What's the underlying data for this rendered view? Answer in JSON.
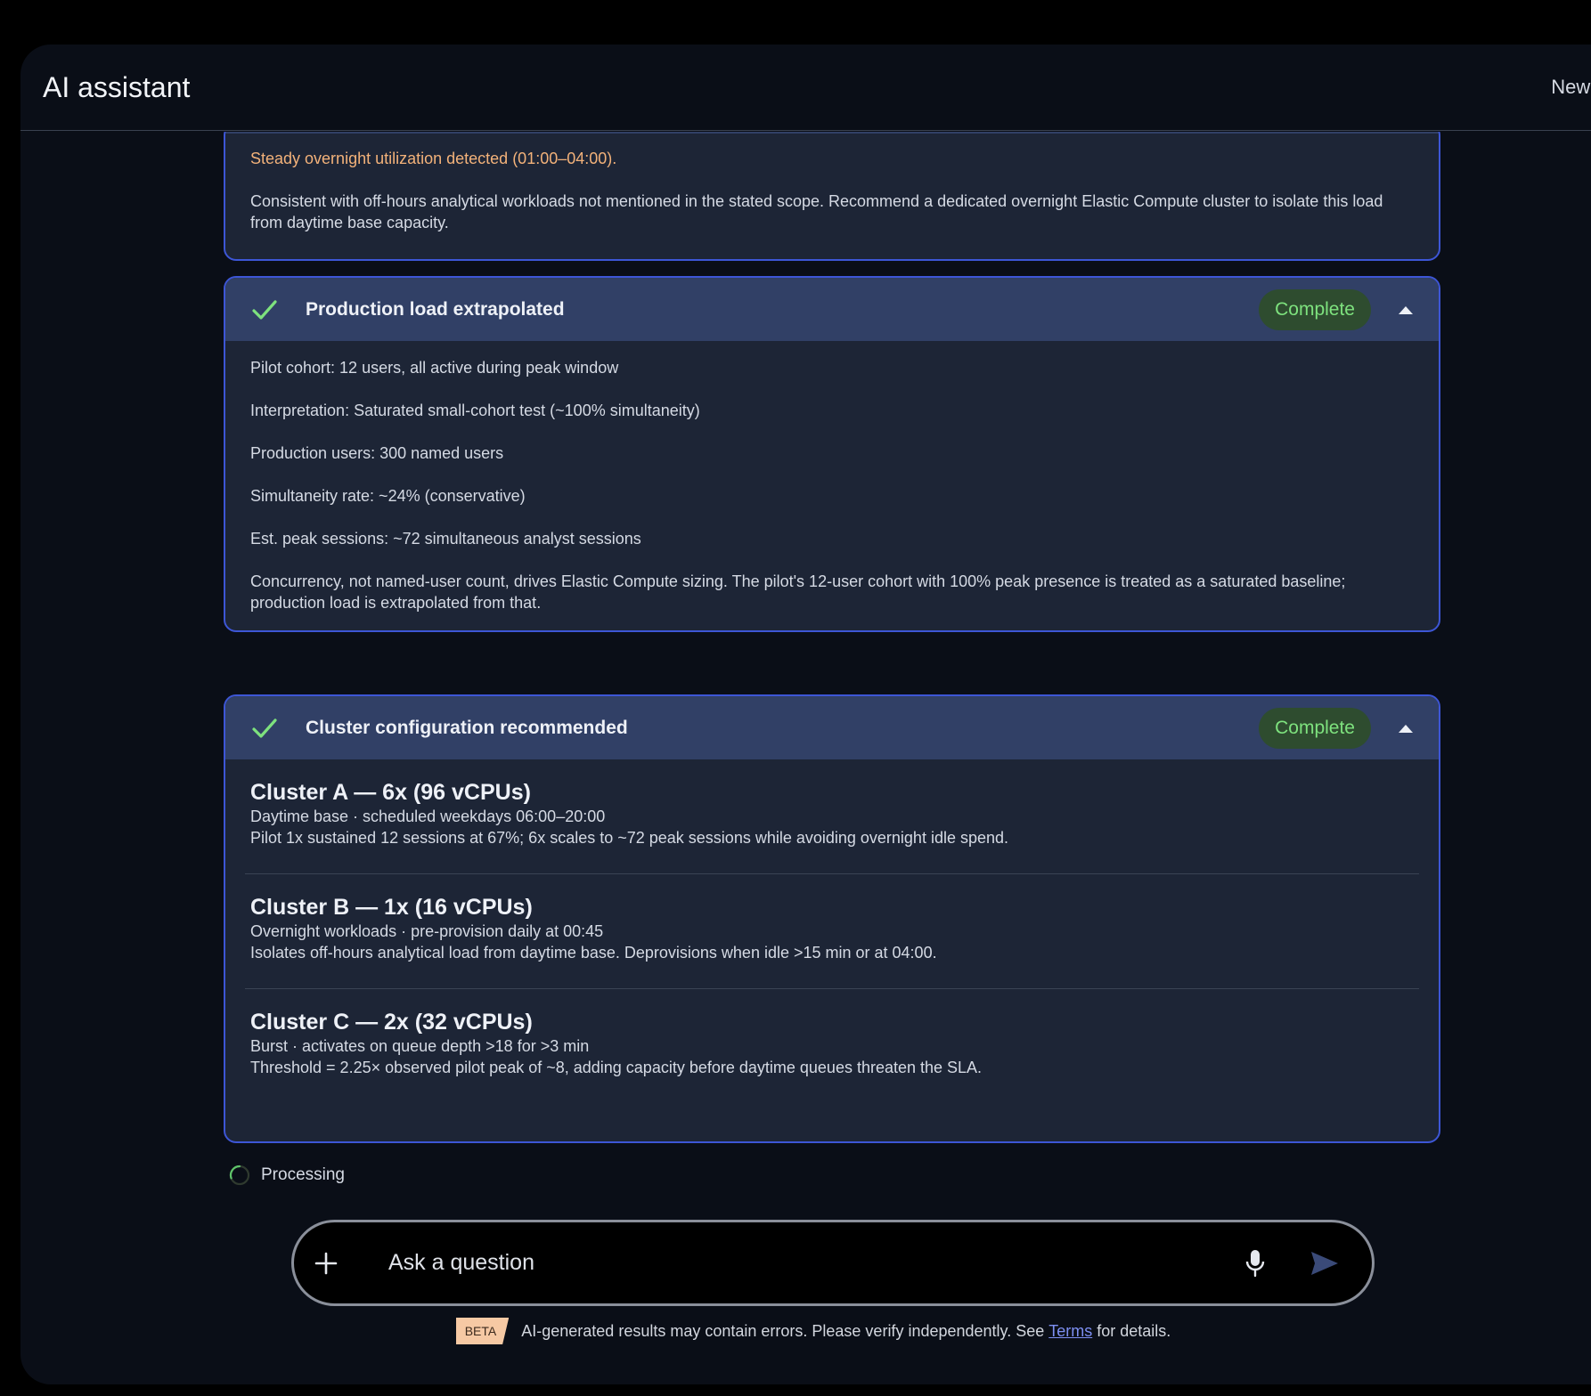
{
  "header": {
    "title": "AI assistant",
    "new_chat": "New chat"
  },
  "card1": {
    "warning": "Steady overnight utilization detected (01:00–04:00).",
    "detail": "Consistent with off-hours analytical workloads not mentioned in the stated scope. Recommend a dedicated overnight Elastic Compute cluster to isolate this load from daytime base capacity."
  },
  "card2": {
    "title": "Production load extrapolated",
    "status": "Complete",
    "lines": [
      "Pilot cohort: 12 users, all active during peak window",
      "Interpretation: Saturated small-cohort test (~100% simultaneity)",
      "Production users: 300 named users",
      "Simultaneity rate: ~24% (conservative)",
      "Est. peak sessions: ~72 simultaneous analyst sessions",
      "Concurrency, not named-user count, drives Elastic Compute sizing. The pilot's 12-user cohort with 100% peak presence is treated as a saturated baseline; production load is extrapolated from that."
    ]
  },
  "card3": {
    "title": "Cluster configuration recommended",
    "status": "Complete",
    "clusters": [
      {
        "title": "Cluster A — 6x (96 vCPUs)",
        "schedule": "Daytime base · scheduled weekdays 06:00–20:00",
        "note": "Pilot 1x sustained 12 sessions at 67%; 6x scales to ~72 peak sessions while avoiding overnight idle spend."
      },
      {
        "title": "Cluster B — 1x (16 vCPUs)",
        "schedule": "Overnight workloads · pre-provision daily at 00:45",
        "note": "Isolates off-hours analytical load from daytime base. Deprovisions when idle >15 min or at 04:00."
      },
      {
        "title": "Cluster C — 2x (32 vCPUs)",
        "schedule": "Burst · activates on queue depth >18 for >3 min",
        "note": "Threshold = 2.25× observed pilot peak of ~8, adding capacity before daytime queues threaten the SLA."
      }
    ]
  },
  "processing": "Processing",
  "composer": {
    "placeholder": "Ask a question"
  },
  "disclaimer": {
    "badge": "BETA",
    "text_before": "AI-generated results may contain errors. Please verify independently. See",
    "link": "Terms",
    "text_after": "for details."
  },
  "colors": {
    "accent_border": "#3d56d6",
    "complete_green": "#7ee27e",
    "warning": "#f3b27a",
    "beta_bg": "#f6c9a4"
  }
}
